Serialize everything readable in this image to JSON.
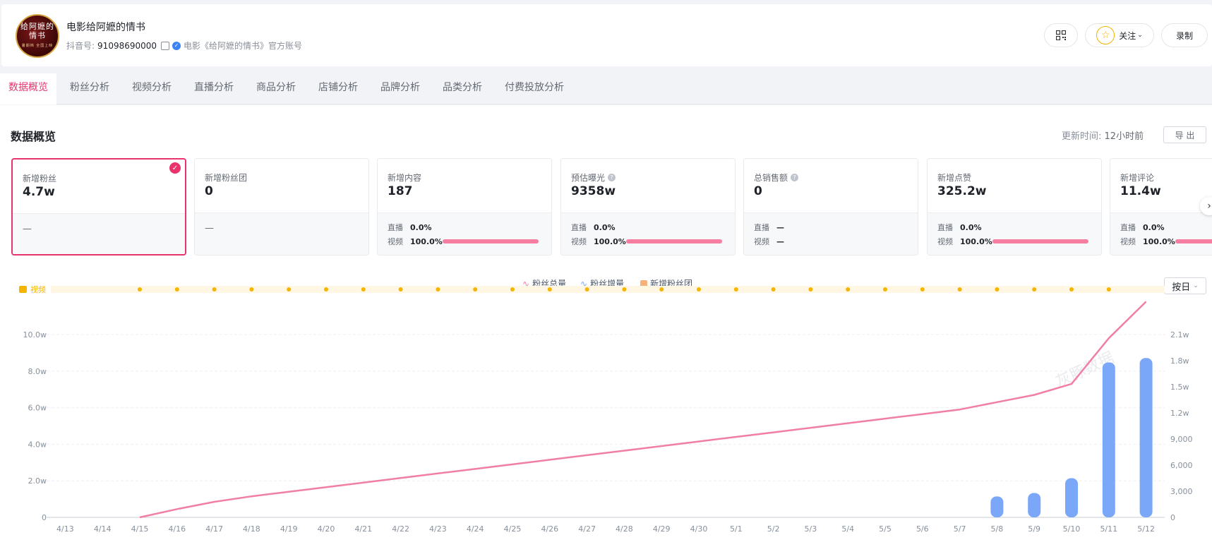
{
  "account": {
    "name": "电影给阿嬷的情书",
    "id_label": "抖音号:",
    "id_value": "91098690000",
    "verify_text": "电影《给阿嬷的情书》官方账号",
    "avatar_text": "给阿嬷的情书",
    "avatar_subtext": "暑期档 全国上映"
  },
  "header_actions": {
    "follow_label": "关注",
    "record_label": "录制"
  },
  "tabs": [
    {
      "label": "数据概览",
      "active": true
    },
    {
      "label": "粉丝分析"
    },
    {
      "label": "视频分析"
    },
    {
      "label": "直播分析"
    },
    {
      "label": "商品分析"
    },
    {
      "label": "店铺分析"
    },
    {
      "label": "品牌分析"
    },
    {
      "label": "品类分析"
    },
    {
      "label": "付费投放分析"
    }
  ],
  "overview": {
    "title": "数据概览",
    "update_label": "更新时间:",
    "update_value": "12小时前",
    "export_label": "导 出"
  },
  "cards": [
    {
      "label": "新增粉丝",
      "value": "4.7w",
      "dash": "—",
      "selected": true
    },
    {
      "label": "新增粉丝团",
      "value": "0",
      "dash": "—"
    },
    {
      "label": "新增内容",
      "value": "187",
      "live_label": "直播",
      "live_pct": "0.0%",
      "video_label": "视频",
      "video_pct": "100.0%",
      "video_fraction": 1.0
    },
    {
      "label": "预估曝光",
      "value": "9358w",
      "help": "?",
      "live_label": "直播",
      "live_pct": "0.0%",
      "video_label": "视频",
      "video_pct": "100.0%",
      "video_fraction": 1.0
    },
    {
      "label": "总销售额",
      "value": "0",
      "help": "?",
      "live_label": "直播",
      "live_pct": "—",
      "video_label": "视频",
      "video_pct": "—"
    },
    {
      "label": "新增点赞",
      "value": "325.2w",
      "live_label": "直播",
      "live_pct": "0.0%",
      "video_label": "视频",
      "video_pct": "100.0%",
      "video_fraction": 1.0
    },
    {
      "label": "新增评论",
      "value": "11.4w",
      "live_label": "直播",
      "live_pct": "0.0%",
      "video_label": "视频",
      "video_pct": "100.0%",
      "video_fraction": 1.0
    }
  ],
  "legend": {
    "total_label": "粉丝总量",
    "increase_label": "粉丝增量",
    "fan_group_label": "新增粉丝团",
    "group_by": "按日"
  },
  "video_track_label": "视频",
  "watermark": "灰豚数据",
  "colors": {
    "accent": "#e8336d",
    "line": "#f07fa3",
    "bar": "#7aa7f7",
    "fan_group": "#f7b27c",
    "video_dot": "#f5b400"
  },
  "chart_data": {
    "type": "bar+line",
    "categories": [
      "4/13",
      "4/14",
      "4/15",
      "4/16",
      "4/17",
      "4/18",
      "4/19",
      "4/20",
      "4/21",
      "4/22",
      "4/23",
      "4/24",
      "4/25",
      "4/26",
      "4/27",
      "4/28",
      "4/29",
      "4/30",
      "5/1",
      "5/2",
      "5/3",
      "5/4",
      "5/5",
      "5/6",
      "5/7",
      "5/8",
      "5/9",
      "5/10",
      "5/11",
      "5/12"
    ],
    "series": [
      {
        "name": "粉丝总量",
        "type": "line",
        "axis": "left",
        "values": [
          null,
          null,
          0,
          4500,
          8500,
          11500,
          14000,
          16500,
          19000,
          21500,
          24000,
          26500,
          29000,
          31500,
          34000,
          36500,
          39000,
          41500,
          44000,
          46500,
          49000,
          51500,
          54000,
          56500,
          59000,
          63000,
          67000,
          73000,
          98000,
          118000
        ]
      },
      {
        "name": "粉丝增量",
        "type": "bar",
        "axis": "right",
        "values": [
          0,
          0,
          0,
          0,
          0,
          0,
          0,
          0,
          0,
          0,
          0,
          0,
          0,
          0,
          0,
          0,
          0,
          0,
          0,
          0,
          0,
          0,
          0,
          0,
          0,
          2400,
          2800,
          4500,
          17800,
          18300
        ]
      },
      {
        "name": "新增粉丝团",
        "type": "bar",
        "axis": "right",
        "values": [
          0,
          0,
          0,
          0,
          0,
          0,
          0,
          0,
          0,
          0,
          0,
          0,
          0,
          0,
          0,
          0,
          0,
          0,
          0,
          0,
          0,
          0,
          0,
          0,
          0,
          0,
          0,
          0,
          0,
          0
        ]
      }
    ],
    "video_markers": [
      "4/15",
      "4/16",
      "4/17",
      "4/18",
      "4/19",
      "4/20",
      "4/21",
      "4/22",
      "4/23",
      "4/24",
      "4/25",
      "4/26",
      "4/27",
      "4/28",
      "4/29",
      "4/30",
      "5/1",
      "5/2",
      "5/3",
      "5/4",
      "5/5",
      "5/6",
      "5/7",
      "5/8",
      "5/9",
      "5/10",
      "5/11"
    ],
    "left_axis": {
      "ticks": [
        "0",
        "2.0w",
        "4.0w",
        "6.0w",
        "8.0w",
        "10.0w"
      ],
      "range": [
        0,
        100000
      ]
    },
    "right_axis": {
      "ticks": [
        "0",
        "3,000",
        "6,000",
        "9,000",
        "1.2w",
        "1.5w",
        "1.8w",
        "2.1w"
      ],
      "range": [
        0,
        21000
      ]
    },
    "grid": true,
    "legend_position": "top-center"
  }
}
